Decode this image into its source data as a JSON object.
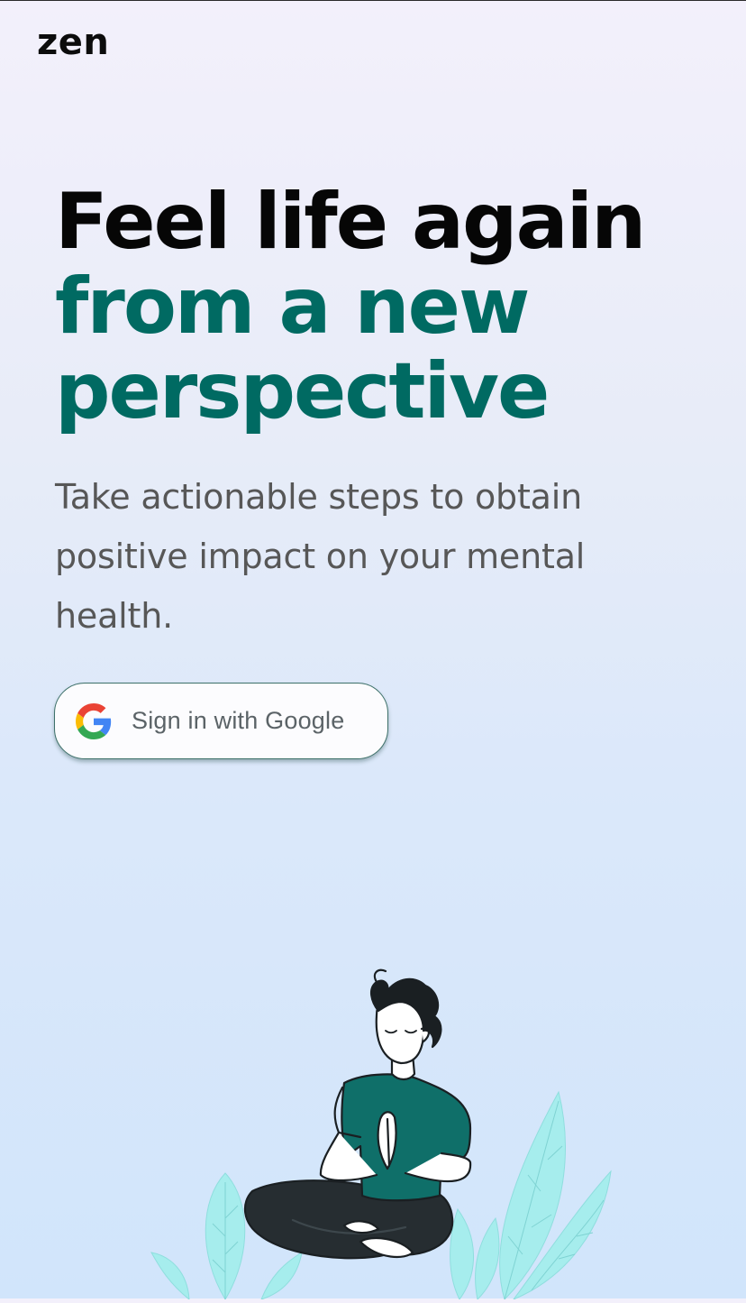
{
  "app": {
    "logo": "zen"
  },
  "hero": {
    "headline_line1": "Feel life again",
    "headline_line2": "from a new",
    "headline_line3": "perspective",
    "subtext": "Take actionable steps to obtain positive impact on your mental health."
  },
  "signin": {
    "label": "Sign in with Google",
    "icon": "google-g-icon"
  },
  "illustration": {
    "subject": "meditating-person-icon",
    "decor": "leaves-icon"
  },
  "colors": {
    "accent": "#006a62",
    "headline": "#060606",
    "body_text": "#575757",
    "button_border": "#3e716a",
    "leaf": "#a6eded",
    "shirt": "#0f6f69",
    "pants": "#262d31"
  }
}
